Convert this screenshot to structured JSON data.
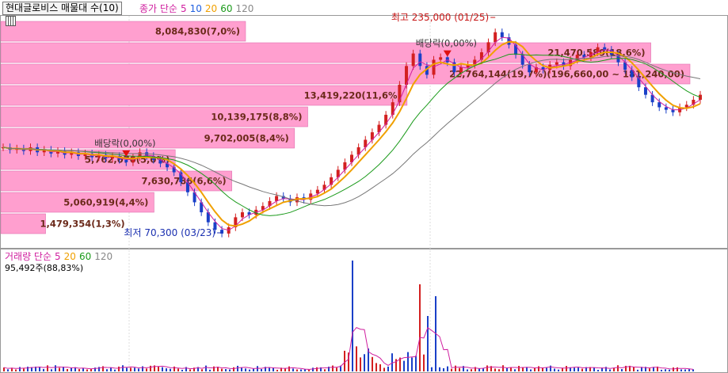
{
  "header": {
    "tab_label": "현대글로비스 매물대 수(10)",
    "price_legend": "종가 단순",
    "ma_periods": [
      "5",
      "10",
      "20",
      "60",
      "120"
    ],
    "ma_colors": [
      "#d01f9f",
      "#2060e0",
      "#f0a000",
      "#1a9a1a",
      "#888888"
    ]
  },
  "volume_header": {
    "label": "거래량 단순",
    "ma_periods": [
      "5",
      "20",
      "60",
      "120"
    ],
    "ma_colors": [
      "#d01f9f",
      "#f0a000",
      "#1a9a1a",
      "#888888"
    ],
    "note": "95,492주(88,83%)"
  },
  "annotations": {
    "high": "최고 235,000 (01/25)",
    "low": "최저 70,300 (03/23)",
    "dividend": "배당락(0,00%)"
  },
  "chart_data": {
    "type": "bar",
    "title": "현대글로비스 매물대 수(10)",
    "orientation": "horizontal",
    "description_of_axis": "price-volume profile bands (top = highest price)",
    "bands": [
      {
        "label": "8,084,830(7,0%)",
        "volume": 8084830,
        "pct": 7.0
      },
      {
        "label": "21,470,589(18,6%)",
        "volume": 21470589,
        "pct": 18.6
      },
      {
        "label": "22,764,144(19,7%)(196,660,00 ~ 181,240,00)",
        "volume": 22764144,
        "pct": 19.7
      },
      {
        "label": "13,419,220(11,6%)",
        "volume": 13419220,
        "pct": 11.6
      },
      {
        "label": "10,139,175(8,8%)",
        "volume": 10139175,
        "pct": 8.8
      },
      {
        "label": "9,702,005(8,4%)",
        "volume": 9702005,
        "pct": 8.4
      },
      {
        "label": "5,762,070(5,0%)",
        "volume": 5762070,
        "pct": 5.0
      },
      {
        "label": "7,630,786(6,6%)",
        "volume": 7630786,
        "pct": 6.6
      },
      {
        "label": "5,060,919(4,4%)",
        "volume": 5060919,
        "pct": 4.4
      },
      {
        "label": "1,479,354(1,3%)",
        "volume": 1479354,
        "pct": 1.3
      }
    ],
    "price_series": {
      "high": 235000,
      "low": 70300,
      "close_path": [
        140,
        138,
        139,
        137,
        140,
        136,
        138,
        135,
        137,
        134,
        136,
        133,
        135,
        132,
        134,
        131,
        133,
        130,
        128,
        132,
        136,
        133,
        130,
        127,
        124,
        120,
        112,
        104,
        96,
        88,
        80,
        74,
        71,
        76,
        84,
        88,
        86,
        90,
        93,
        97,
        101,
        99,
        96,
        100,
        98,
        103,
        106,
        110,
        116,
        122,
        128,
        134,
        140,
        146,
        152,
        158,
        166,
        176,
        190,
        205,
        215,
        205,
        198,
        210,
        212,
        208,
        200,
        204,
        206,
        210,
        216,
        224,
        232,
        228,
        222,
        214,
        206,
        200,
        204,
        202,
        206,
        208,
        205,
        210,
        214,
        212,
        216,
        220,
        218,
        214,
        208,
        202,
        196,
        188,
        182,
        176,
        172,
        170,
        168,
        172,
        174,
        178,
        182
      ]
    }
  }
}
